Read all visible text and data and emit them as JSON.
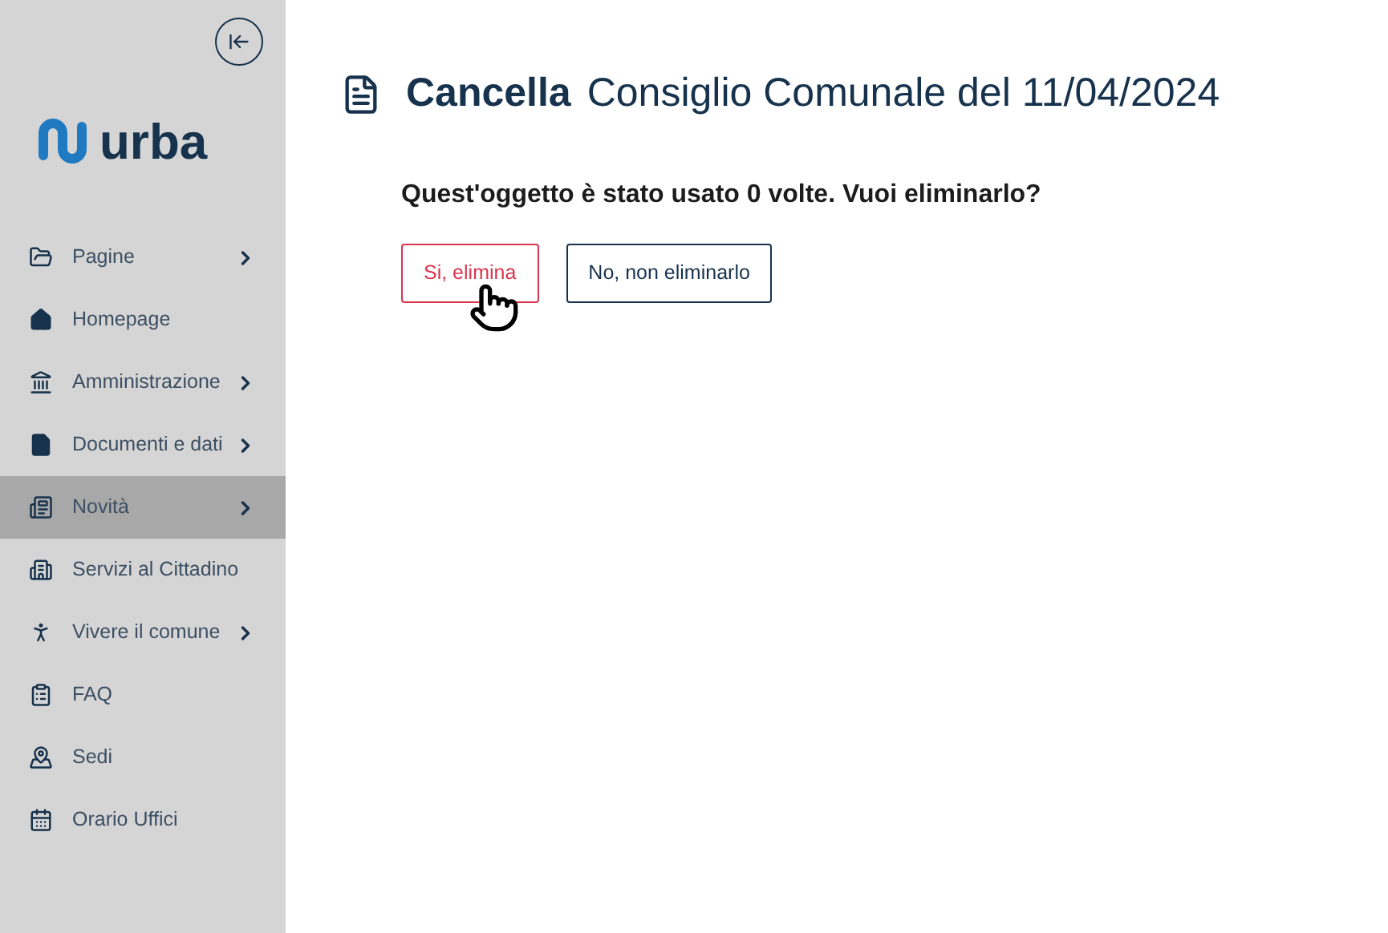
{
  "sidebar": {
    "logo_text": "urba",
    "items": [
      {
        "label": "Pagine",
        "has_submenu": true,
        "selected": false
      },
      {
        "label": "Homepage",
        "has_submenu": false,
        "selected": false
      },
      {
        "label": "Amministrazione",
        "has_submenu": true,
        "selected": false
      },
      {
        "label": "Documenti e dati",
        "has_submenu": true,
        "selected": false
      },
      {
        "label": "Novità",
        "has_submenu": true,
        "selected": true
      },
      {
        "label": "Servizi al Cittadino",
        "has_submenu": false,
        "selected": false
      },
      {
        "label": "Vivere il comune",
        "has_submenu": true,
        "selected": false
      },
      {
        "label": "FAQ",
        "has_submenu": false,
        "selected": false
      },
      {
        "label": "Sedi",
        "has_submenu": false,
        "selected": false
      },
      {
        "label": "Orario Uffici",
        "has_submenu": false,
        "selected": false
      }
    ]
  },
  "page": {
    "title_action": "Cancella",
    "title_subject": "Consiglio Comunale del 11/04/2024",
    "question": "Quest'oggetto è stato usato 0 volte. Vuoi eliminarlo?",
    "buttons": [
      {
        "label": "Si, elimina",
        "kind": "danger"
      },
      {
        "label": "No, non eliminarlo",
        "kind": "secondary"
      }
    ]
  }
}
